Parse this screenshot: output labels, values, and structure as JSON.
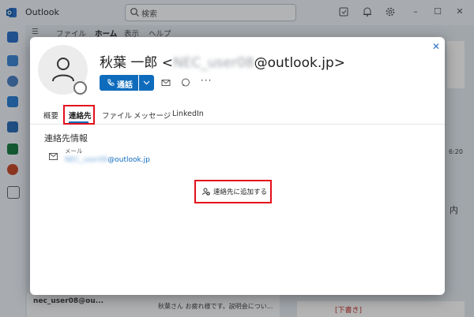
{
  "app": {
    "title": "Outlook",
    "search_placeholder": "検索"
  },
  "ribbon": {
    "tabs": [
      "ファイル",
      "ホーム",
      "表示",
      "ヘルプ"
    ]
  },
  "background": {
    "folder_item": "nec_user08@ou...",
    "message_snippet": "秋葉さん お疲れ様です。説明会につい...",
    "time": "6:20",
    "side_text": "内",
    "draft_label": "[下書き]"
  },
  "card": {
    "name_prefix": "秋葉 一郎 <",
    "name_blurred": "NEC_user08",
    "name_suffix": "@outlook.jp>",
    "call_label": "通話",
    "tabs": [
      "概要",
      "連絡先",
      "ファイル",
      "メッセージ",
      "LinkedIn"
    ],
    "active_tab": "連絡先",
    "section_title": "連絡先情報",
    "email_label": "メール",
    "email_blurred": "NEC_user08",
    "email_domain": "@outlook.jp",
    "add_contact_label": "連絡先に追加する"
  },
  "colors": {
    "accent": "#0f6cbd",
    "highlight": "#e30f1b"
  }
}
